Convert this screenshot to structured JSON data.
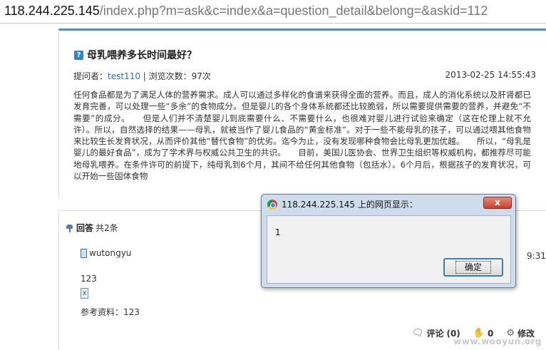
{
  "browser": {
    "url_host": "118.244.225.145",
    "url_path": "/index.php?m=ask&c=index&a=question_detail&belong=&askid=112"
  },
  "question": {
    "title": "母乳喂养多长时间最好？",
    "asker_label": "提问者：",
    "asker_name": "test110",
    "views": " | 浏览次数：97次",
    "date": "2013-02-25 14:55:43",
    "body": "任何食品都是为了满足人体的营养需求。成人可以通过多样化的食谱来获得全面的营养。而且，成人的消化系统以及肝肾都已发育完善，可以处理一些“多余”的食物成分。但是婴儿的各个身体系统都还比较脆弱，所以需要提供需要的营养，并避免“不需要”的成分。　　但是人们并不清楚婴儿到底需要什么、不需要什么，也很难对婴儿进行试验来确定（这在伦理上就不允许）。所以，自然选择的结果——母乳，就被当作了婴儿食品的“黄金标准”。对于一些不能母乳的孩子，可以通过喂其他食物来比较生长发育状况，从而评价其他“替代食物”的优劣。迄今为止，没有发现哪种食物会比母乳更加优越。　　所以，“母乳是婴儿的最好食品”，成为了学术界与权威公共卫生的共识。　　目前，美国儿医协会、世界卫生组织等权威机构，都推荐尽可能地母乳喂养。在条件许可的前提下，纯母乳到6个月，其间不给任何其他食物（包括水）。6个月后，根据孩子的发育状况，可以开始一些固体食物"
  },
  "answers": {
    "heading": "回答",
    "count": "共2条",
    "items": [
      {
        "user": "wutongyu",
        "time": "9:31",
        "content": "123",
        "reference": "参考资料：123",
        "comment_label": "评论",
        "comment_count": "(0)",
        "like_count": "0",
        "edit_label": "修改"
      }
    ]
  },
  "dialog": {
    "title": "118.244.225.145 上的网页显示：",
    "message": "1",
    "ok_label": "确定",
    "close_glyph": "x"
  },
  "watermark": "www.wooyun.org"
}
